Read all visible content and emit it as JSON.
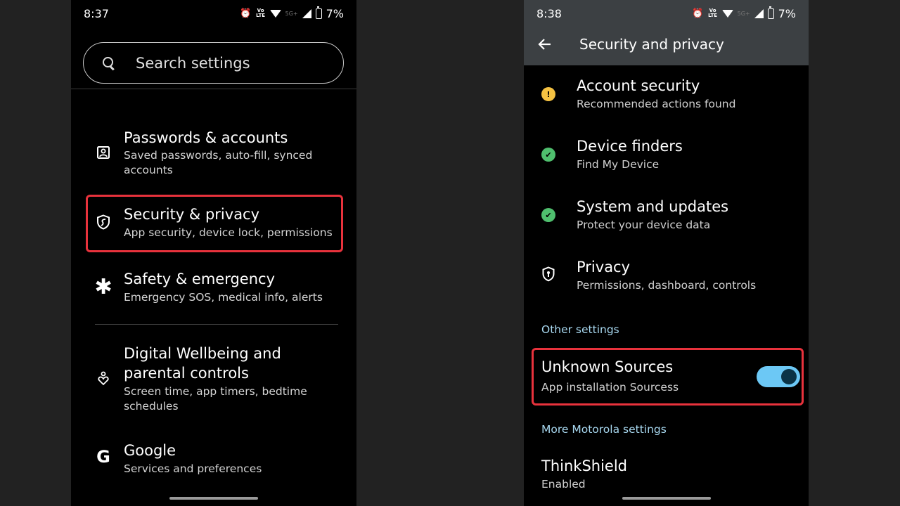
{
  "left_screen": {
    "status_bar": {
      "time": "8:37",
      "battery": "7%",
      "network": "5G+",
      "volte": "VoLTE"
    },
    "search": {
      "placeholder": "Search settings"
    },
    "items": [
      {
        "icon": "account-box-icon",
        "title": "Passwords & accounts",
        "subtitle": "Saved passwords, auto-fill, synced accounts"
      },
      {
        "icon": "shield-icon",
        "title": "Security & privacy",
        "subtitle": "App security, device lock, permissions",
        "highlighted": true
      },
      {
        "icon": "asterisk-icon",
        "title": "Safety & emergency",
        "subtitle": "Emergency SOS, medical info, alerts"
      },
      {
        "icon": "wellbeing-heart-icon",
        "title": "Digital Wellbeing and parental controls",
        "subtitle": "Screen time, app timers, bedtime schedules"
      },
      {
        "icon": "google-g-icon",
        "title": "Google",
        "subtitle": "Services and preferences"
      }
    ]
  },
  "right_screen": {
    "status_bar": {
      "time": "8:38",
      "battery": "7%",
      "network": "5G+",
      "volte": "VoLTE"
    },
    "header": {
      "title": "Security and privacy",
      "back_icon": "arrow-back-icon"
    },
    "items": [
      {
        "icon": "warning-dot-icon",
        "status": "warning",
        "title": "Account security",
        "subtitle": "Recommended actions found"
      },
      {
        "icon": "check-dot-icon",
        "status": "ok",
        "title": "Device finders",
        "subtitle": "Find My Device"
      },
      {
        "icon": "check-dot-icon",
        "status": "ok",
        "title": "System and updates",
        "subtitle": "Protect your device data"
      },
      {
        "icon": "privacy-shield-icon",
        "title": "Privacy",
        "subtitle": "Permissions, dashboard, controls"
      }
    ],
    "other_settings_header": "Other settings",
    "unknown_sources": {
      "title": "Unknown Sources",
      "subtitle": "App installation Sourcess",
      "enabled": true,
      "highlighted": true
    },
    "motorola_header": "More Motorola settings",
    "thinkshield": {
      "title": "ThinkShield",
      "subtitle": "Enabled"
    }
  },
  "colors": {
    "highlight": "#e8323c",
    "toggle_track": "#6cc8f5",
    "toggle_thumb": "#0b3346",
    "warning": "#f5c242",
    "ok": "#4fbf6e",
    "section_header": "#a8d8f0",
    "app_bar": "#3c4043"
  }
}
